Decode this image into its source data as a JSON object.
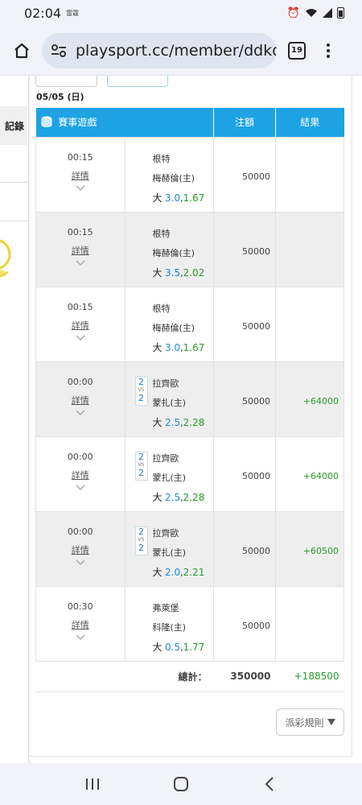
{
  "status": {
    "time": "02:04",
    "sim_label": "雷霆"
  },
  "browser": {
    "url": "playsport.cc/member/ddkddl",
    "tab_count": "19"
  },
  "sidebar": {
    "record_label": "記錄"
  },
  "top_buttons": [
    "",
    ""
  ],
  "date": "05/05 (日)",
  "table": {
    "headers": {
      "game": "賽事遊戲",
      "amount": "注額",
      "result": "結果"
    },
    "detail_label": "詳情",
    "rows": [
      {
        "time": "00:15",
        "away": "根特",
        "home": "梅赫倫(主)",
        "ou": "大",
        "hc": "3.0",
        "odds": "1.67",
        "amount": "50000",
        "result": "",
        "score": null
      },
      {
        "time": "00:15",
        "away": "根特",
        "home": "梅赫倫(主)",
        "ou": "大",
        "hc": "3.5",
        "odds": "2.02",
        "amount": "50000",
        "result": "",
        "score": null
      },
      {
        "time": "00:15",
        "away": "根特",
        "home": "梅赫倫(主)",
        "ou": "大",
        "hc": "3.0",
        "odds": "1.67",
        "amount": "50000",
        "result": "",
        "score": null
      },
      {
        "time": "00:00",
        "away": "拉齊歐",
        "home": "蒙扎(主)",
        "ou": "大",
        "hc": "2.5",
        "odds": "2.28",
        "amount": "50000",
        "result": "+64000",
        "score": [
          "2",
          "2"
        ]
      },
      {
        "time": "00:00",
        "away": "拉齊歐",
        "home": "蒙扎(主)",
        "ou": "大",
        "hc": "2.5",
        "odds": "2.28",
        "amount": "50000",
        "result": "+64000",
        "score": [
          "2",
          "2"
        ]
      },
      {
        "time": "00:00",
        "away": "拉齊歐",
        "home": "蒙扎(主)",
        "ou": "大",
        "hc": "2.0",
        "odds": "2.21",
        "amount": "50000",
        "result": "+60500",
        "score": [
          "2",
          "2"
        ]
      },
      {
        "time": "00:30",
        "away": "弗萊堡",
        "home": "科隆(主)",
        "ou": "大",
        "hc": "0.5",
        "odds": "1.77",
        "amount": "50000",
        "result": "",
        "score": null
      }
    ],
    "vs_label": "VS",
    "total": {
      "label": "總計：",
      "amount": "350000",
      "result": "+188500"
    }
  },
  "rules_button": "派彩規則",
  "colors": {
    "header": "#1da3e3",
    "win": "#2a9a2a",
    "handicap": "#1a8ad6"
  }
}
